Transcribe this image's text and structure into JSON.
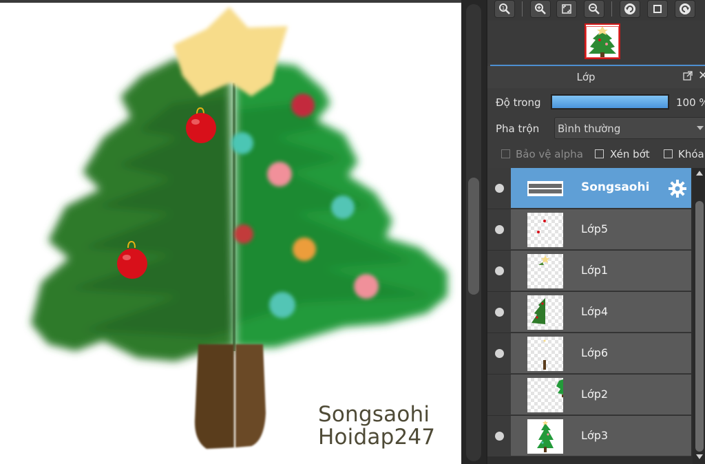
{
  "watermark": {
    "line1": "Songsaohi",
    "line2": "Hoidap247"
  },
  "toolbar": {
    "buttons": [
      "zoom-actual-icon",
      "zoom-in-icon",
      "fit-screen-icon",
      "zoom-out-icon",
      "rotate-left-icon",
      "fullscreen-icon",
      "rotate-right-icon"
    ]
  },
  "layer_panel": {
    "title": "Lớp",
    "opacity_label": "Độ trong",
    "opacity_value": "100 %",
    "opacity_percent": 100,
    "blend_label": "Pha trộn",
    "blend_value": "Bình thường",
    "protect_alpha_label": "Bảo vệ alpha",
    "clipping_label": "Xén bớt",
    "lock_label": "Khóa",
    "layers": [
      {
        "name": "Songsaohi",
        "selected": true,
        "visible": true,
        "thumb": "text"
      },
      {
        "name": "Lớp5",
        "selected": false,
        "visible": true,
        "thumb": "dots"
      },
      {
        "name": "Lớp1",
        "selected": false,
        "visible": true,
        "thumb": "star"
      },
      {
        "name": "Lớp4",
        "selected": false,
        "visible": true,
        "thumb": "tree-left"
      },
      {
        "name": "Lớp6",
        "selected": false,
        "visible": true,
        "thumb": "trunk"
      },
      {
        "name": "Lớp2",
        "selected": false,
        "visible": false,
        "thumb": "tree-right"
      },
      {
        "name": "Lớp3",
        "selected": false,
        "visible": true,
        "thumb": "tree-full"
      }
    ]
  },
  "colors": {
    "accent": "#5f9fd6",
    "tree_dark": "#2f7a2a",
    "tree_light": "#239a3a",
    "star": "#f7dc8a",
    "trunk": "#5a3c1c",
    "ornament_red": "#d8101a"
  }
}
